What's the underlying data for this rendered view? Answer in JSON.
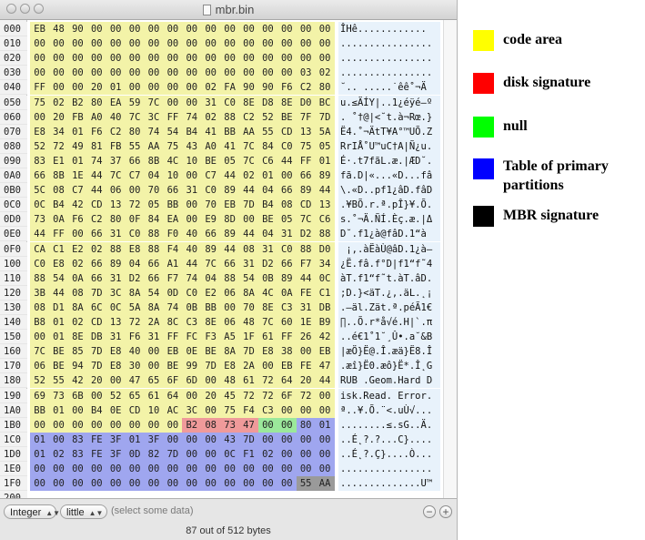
{
  "window": {
    "title": "mbr.bin"
  },
  "hex_rows": [
    {
      "offset": "000",
      "bytes": [
        "EB",
        "48",
        "90",
        "00",
        "00",
        "00",
        "00",
        "00",
        "00",
        "00",
        "00",
        "00",
        "00",
        "00",
        "00",
        "00"
      ],
      "ascii": "ÎHê............"
    },
    {
      "offset": "010",
      "bytes": [
        "00",
        "00",
        "00",
        "00",
        "00",
        "00",
        "00",
        "00",
        "00",
        "00",
        "00",
        "00",
        "00",
        "00",
        "00",
        "00"
      ],
      "ascii": "................"
    },
    {
      "offset": "020",
      "bytes": [
        "00",
        "00",
        "00",
        "00",
        "00",
        "00",
        "00",
        "00",
        "00",
        "00",
        "00",
        "00",
        "00",
        "00",
        "00",
        "00"
      ],
      "ascii": "................"
    },
    {
      "offset": "030",
      "bytes": [
        "00",
        "00",
        "00",
        "00",
        "00",
        "00",
        "00",
        "00",
        "00",
        "00",
        "00",
        "00",
        "00",
        "00",
        "03",
        "02"
      ],
      "ascii": "................"
    },
    {
      "offset": "040",
      "bytes": [
        "FF",
        "00",
        "00",
        "20",
        "01",
        "00",
        "00",
        "00",
        "00",
        "02",
        "FA",
        "90",
        "90",
        "F6",
        "C2",
        "80"
      ],
      "ascii": "˘.. .....˙êê˚¬Ä"
    },
    {
      "offset": "050",
      "bytes": [
        "75",
        "02",
        "B2",
        "80",
        "EA",
        "59",
        "7C",
        "00",
        "00",
        "31",
        "C0",
        "8E",
        "D8",
        "8E",
        "D0",
        "BC"
      ],
      "ascii": "u.≤ÄÍY|..1¿éÿé–º"
    },
    {
      "offset": "060",
      "bytes": [
        "00",
        "20",
        "FB",
        "A0",
        "40",
        "7C",
        "3C",
        "FF",
        "74",
        "02",
        "88",
        "C2",
        "52",
        "BE",
        "7F",
        "7D"
      ],
      "ascii": ". ˚†@|<˘t.à¬Rœ.}"
    },
    {
      "offset": "070",
      "bytes": [
        "E8",
        "34",
        "01",
        "F6",
        "C2",
        "80",
        "74",
        "54",
        "B4",
        "41",
        "BB",
        "AA",
        "55",
        "CD",
        "13",
        "5A"
      ],
      "ascii": "Ë4.˚¬ÄtT¥A°™UÕ.Z"
    },
    {
      "offset": "080",
      "bytes": [
        "52",
        "72",
        "49",
        "81",
        "FB",
        "55",
        "AA",
        "75",
        "43",
        "A0",
        "41",
        "7C",
        "84",
        "C0",
        "75",
        "05"
      ],
      "ascii": "RrIÅ˚U™uC†A|Ñ¿u."
    },
    {
      "offset": "090",
      "bytes": [
        "83",
        "E1",
        "01",
        "74",
        "37",
        "66",
        "8B",
        "4C",
        "10",
        "BE",
        "05",
        "7C",
        "C6",
        "44",
        "FF",
        "01"
      ],
      "ascii": "É·.t7fãL.æ.|ÆD˘."
    },
    {
      "offset": "0A0",
      "bytes": [
        "66",
        "8B",
        "1E",
        "44",
        "7C",
        "C7",
        "04",
        "10",
        "00",
        "C7",
        "44",
        "02",
        "01",
        "00",
        "66",
        "89"
      ],
      "ascii": "fã.D|«...«D...fâ"
    },
    {
      "offset": "0B0",
      "bytes": [
        "5C",
        "08",
        "C7",
        "44",
        "06",
        "00",
        "70",
        "66",
        "31",
        "C0",
        "89",
        "44",
        "04",
        "66",
        "89",
        "44"
      ],
      "ascii": "\\.«D..pf1¿âD.fâD"
    },
    {
      "offset": "0C0",
      "bytes": [
        "0C",
        "B4",
        "42",
        "CD",
        "13",
        "72",
        "05",
        "BB",
        "00",
        "70",
        "EB",
        "7D",
        "B4",
        "08",
        "CD",
        "13"
      ],
      "ascii": ".¥BÕ.r.ª.pÎ}¥.Õ."
    },
    {
      "offset": "0D0",
      "bytes": [
        "73",
        "0A",
        "F6",
        "C2",
        "80",
        "0F",
        "84",
        "EA",
        "00",
        "E9",
        "8D",
        "00",
        "BE",
        "05",
        "7C",
        "C6"
      ],
      "ascii": "s.˚¬Ä.ÑÍ.Èç.æ.|Δ"
    },
    {
      "offset": "0E0",
      "bytes": [
        "44",
        "FF",
        "00",
        "66",
        "31",
        "C0",
        "88",
        "F0",
        "40",
        "66",
        "89",
        "44",
        "04",
        "31",
        "D2",
        "88"
      ],
      "ascii": "D˘.f1¿à@fâD.1“à"
    },
    {
      "offset": "0F0",
      "bytes": [
        "CA",
        "C1",
        "E2",
        "02",
        "88",
        "E8",
        "88",
        "F4",
        "40",
        "89",
        "44",
        "08",
        "31",
        "C0",
        "88",
        "D0"
      ],
      "ascii": " ¡‚.àËàÙ@âD.1¿à–"
    },
    {
      "offset": "100",
      "bytes": [
        "C0",
        "E8",
        "02",
        "66",
        "89",
        "04",
        "66",
        "A1",
        "44",
        "7C",
        "66",
        "31",
        "D2",
        "66",
        "F7",
        "34"
      ],
      "ascii": "¿Ë.fâ.f°D|f1“f˜4"
    },
    {
      "offset": "110",
      "bytes": [
        "88",
        "54",
        "0A",
        "66",
        "31",
        "D2",
        "66",
        "F7",
        "74",
        "04",
        "88",
        "54",
        "0B",
        "89",
        "44",
        "0C"
      ],
      "ascii": "àT.f1“f˜t.àT.âD."
    },
    {
      "offset": "120",
      "bytes": [
        "3B",
        "44",
        "08",
        "7D",
        "3C",
        "8A",
        "54",
        "0D",
        "C0",
        "E2",
        "06",
        "8A",
        "4C",
        "0A",
        "FE",
        "C1"
      ],
      "ascii": ";D.}<äT.¿‚.äL.˛¡"
    },
    {
      "offset": "130",
      "bytes": [
        "08",
        "D1",
        "8A",
        "6C",
        "0C",
        "5A",
        "8A",
        "74",
        "0B",
        "BB",
        "00",
        "70",
        "8E",
        "C3",
        "31",
        "DB"
      ],
      "ascii": ".–äl.Zät.ª.péÃ1€"
    },
    {
      "offset": "140",
      "bytes": [
        "B8",
        "01",
        "02",
        "CD",
        "13",
        "72",
        "2A",
        "8C",
        "C3",
        "8E",
        "06",
        "48",
        "7C",
        "60",
        "1E",
        "B9"
      ],
      "ascii": "∏..Õ.r*å√é.H|`.π"
    },
    {
      "offset": "150",
      "bytes": [
        "00",
        "01",
        "8E",
        "DB",
        "31",
        "F6",
        "31",
        "FF",
        "FC",
        "F3",
        "A5",
        "1F",
        "61",
        "FF",
        "26",
        "42"
      ],
      "ascii": "..é€1˚1˘¸Û•.a˘&B"
    },
    {
      "offset": "160",
      "bytes": [
        "7C",
        "BE",
        "85",
        "7D",
        "E8",
        "40",
        "00",
        "EB",
        "0E",
        "BE",
        "8A",
        "7D",
        "E8",
        "38",
        "00",
        "EB"
      ],
      "ascii": "|æÖ}Ë@.Î.æä}Ë8.Î"
    },
    {
      "offset": "170",
      "bytes": [
        "06",
        "BE",
        "94",
        "7D",
        "E8",
        "30",
        "00",
        "BE",
        "99",
        "7D",
        "E8",
        "2A",
        "00",
        "EB",
        "FE",
        "47"
      ],
      "ascii": ".æî}Ë0.æô}Ë*.Î˛G"
    },
    {
      "offset": "180",
      "bytes": [
        "52",
        "55",
        "42",
        "20",
        "00",
        "47",
        "65",
        "6F",
        "6D",
        "00",
        "48",
        "61",
        "72",
        "64",
        "20",
        "44"
      ],
      "ascii": "RUB .Geom.Hard D"
    },
    {
      "offset": "190",
      "bytes": [
        "69",
        "73",
        "6B",
        "00",
        "52",
        "65",
        "61",
        "64",
        "00",
        "20",
        "45",
        "72",
        "72",
        "6F",
        "72",
        "00"
      ],
      "ascii": "isk.Read. Error."
    },
    {
      "offset": "1A0",
      "bytes": [
        "BB",
        "01",
        "00",
        "B4",
        "0E",
        "CD",
        "10",
        "AC",
        "3C",
        "00",
        "75",
        "F4",
        "C3",
        "00",
        "00",
        "00"
      ],
      "ascii": "ª..¥.Õ.¨<.uÙ√..."
    },
    {
      "offset": "1B0",
      "bytes": [
        "00",
        "00",
        "00",
        "00",
        "00",
        "00",
        "00",
        "00",
        "B2",
        "08",
        "73",
        "47",
        "00",
        "00",
        "80",
        "01"
      ],
      "ascii": "........≤.sG..Ä."
    },
    {
      "offset": "1C0",
      "bytes": [
        "01",
        "00",
        "83",
        "FE",
        "3F",
        "01",
        "3F",
        "00",
        "00",
        "00",
        "43",
        "7D",
        "00",
        "00",
        "00",
        "00"
      ],
      "ascii": "..É˛?.?...C}...."
    },
    {
      "offset": "1D0",
      "bytes": [
        "01",
        "02",
        "83",
        "FE",
        "3F",
        "0D",
        "82",
        "7D",
        "00",
        "00",
        "0C",
        "F1",
        "02",
        "00",
        "00",
        "00"
      ],
      "ascii": "..É˛?.Ç}....Ò..."
    },
    {
      "offset": "1E0",
      "bytes": [
        "00",
        "00",
        "00",
        "00",
        "00",
        "00",
        "00",
        "00",
        "00",
        "00",
        "00",
        "00",
        "00",
        "00",
        "00",
        "00"
      ],
      "ascii": "................"
    },
    {
      "offset": "1F0",
      "bytes": [
        "00",
        "00",
        "00",
        "00",
        "00",
        "00",
        "00",
        "00",
        "00",
        "00",
        "00",
        "00",
        "00",
        "00",
        "55",
        "AA"
      ],
      "ascii": "..............U™"
    },
    {
      "offset": "200",
      "bytes": [],
      "ascii": ""
    }
  ],
  "toolbar": {
    "type_select": "Integer",
    "endian_select": "little",
    "hint": "(select some data)",
    "remove_button": "−",
    "add_button": "+"
  },
  "status": {
    "text": "87 out of 512 bytes"
  },
  "legend": [
    {
      "label": "code area",
      "color": "#ffff00"
    },
    {
      "label": "disk signature",
      "color": "#ff0000"
    },
    {
      "label": "null",
      "color": "#00ff00"
    },
    {
      "label": "Table of primary partitions",
      "color": "#0000ff"
    },
    {
      "label": "MBR signature",
      "color": "#000000"
    }
  ],
  "region_colors": {
    "code": "#f3f3a8",
    "disk_signature": "#ef9a9a",
    "null": "#9be89b",
    "partition_table": "#9fa6ef",
    "mbr_signature": "#9a9a9a",
    "plain": "#ffffff"
  }
}
